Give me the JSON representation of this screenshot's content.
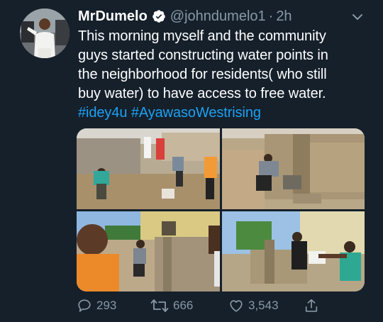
{
  "tweet": {
    "author_name": "MrDumelo",
    "handle": "@johndumelo1",
    "separator": "·",
    "time": "2h",
    "text_line1": "This morning myself and the community",
    "text_line2": "guys started constructing water points in",
    "text_line3": "the neighborhood for residents( who still",
    "text_line4": "buy water) to have access to free water.",
    "hashtag1": "#idey4u",
    "hashtag2": "#AyawasoWestrising"
  },
  "actions": {
    "replies": "293",
    "retweets": "666",
    "likes": "3,543"
  },
  "colors": {
    "background": "#15202b",
    "secondary_text": "#8899a6",
    "link": "#1da1f2"
  },
  "icons": [
    "verified-badge-icon",
    "chevron-down-icon",
    "reply-icon",
    "retweet-icon",
    "like-icon",
    "share-icon"
  ]
}
